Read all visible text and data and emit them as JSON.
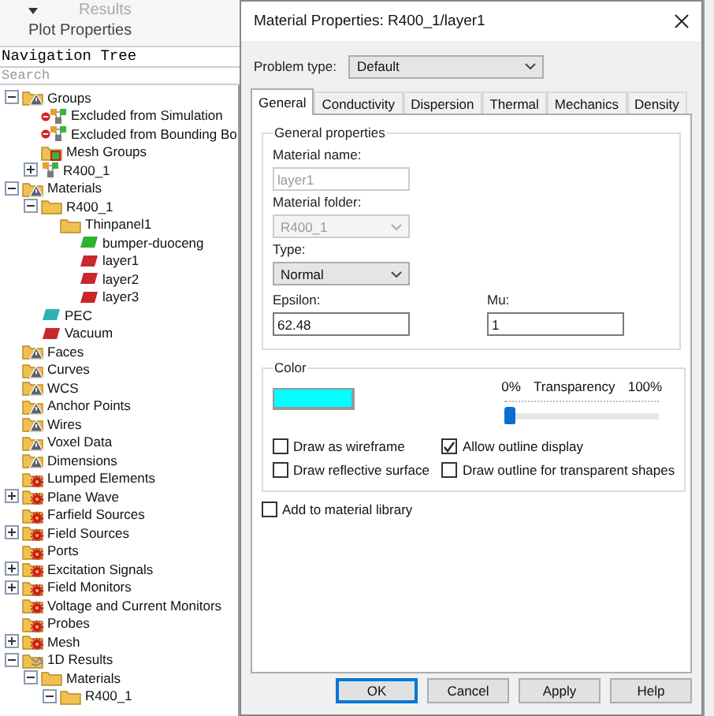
{
  "app": {
    "ribbon_tab": "Results",
    "ribbon_group": "Plot Properties"
  },
  "navigation_tree": {
    "title": "Navigation Tree",
    "search": {
      "placeholder": "Search"
    },
    "items": [
      {
        "label": "Groups",
        "kind": "warn-folder",
        "expanded": true,
        "children": [
          {
            "label": "Excluded from Simulation",
            "kind": "excluded-group"
          },
          {
            "label": "Excluded from Bounding Bo",
            "kind": "excluded-group"
          },
          {
            "label": "Mesh Groups",
            "kind": "mesh-folder"
          },
          {
            "label": "R400_1",
            "kind": "group",
            "expanded": false
          }
        ]
      },
      {
        "label": "Materials",
        "kind": "warn-folder",
        "expanded": true,
        "children": [
          {
            "label": "R400_1",
            "kind": "folder",
            "expanded": true,
            "children": [
              {
                "label": "Thinpanel1",
                "kind": "folder",
                "children": [
                  {
                    "label": "bumper-duoceng",
                    "kind": "material",
                    "color": "#2db42d"
                  },
                  {
                    "label": "layer1",
                    "kind": "material",
                    "color": "#c8282d"
                  },
                  {
                    "label": "layer2",
                    "kind": "material",
                    "color": "#c8282d"
                  },
                  {
                    "label": "layer3",
                    "kind": "material",
                    "color": "#c8282d"
                  }
                ]
              }
            ]
          },
          {
            "label": "PEC",
            "kind": "material",
            "color": "#2fb3b0"
          },
          {
            "label": "Vacuum",
            "kind": "material",
            "color": "#c8282d"
          }
        ]
      },
      {
        "label": "Faces",
        "kind": "warn-folder"
      },
      {
        "label": "Curves",
        "kind": "warn-folder"
      },
      {
        "label": "WCS",
        "kind": "warn-folder"
      },
      {
        "label": "Anchor Points",
        "kind": "warn-folder"
      },
      {
        "label": "Wires",
        "kind": "warn-folder"
      },
      {
        "label": "Voxel Data",
        "kind": "warn-folder"
      },
      {
        "label": "Dimensions",
        "kind": "warn-folder"
      },
      {
        "label": "Lumped Elements",
        "kind": "gear-folder"
      },
      {
        "label": "Plane Wave",
        "kind": "gear-folder",
        "expanded": false
      },
      {
        "label": "Farfield Sources",
        "kind": "gear-folder"
      },
      {
        "label": "Field Sources",
        "kind": "gear-folder",
        "expanded": false
      },
      {
        "label": "Ports",
        "kind": "gear-folder"
      },
      {
        "label": "Excitation Signals",
        "kind": "gear-folder",
        "expanded": false
      },
      {
        "label": "Field Monitors",
        "kind": "gear-folder",
        "expanded": false
      },
      {
        "label": "Voltage and Current Monitors",
        "kind": "gear-folder"
      },
      {
        "label": "Probes",
        "kind": "gear-folder"
      },
      {
        "label": "Mesh",
        "kind": "gear-folder",
        "expanded": false
      },
      {
        "label": "1D Results",
        "kind": "results-folder",
        "expanded": true,
        "children": [
          {
            "label": "Materials",
            "kind": "folder",
            "expanded": true,
            "children": [
              {
                "label": "R400_1",
                "kind": "folder",
                "expanded": true
              }
            ]
          }
        ]
      }
    ]
  },
  "dialog": {
    "title": "Material Properties: R400_1/layer1",
    "problem_type": {
      "label": "Problem type:",
      "value": "Default"
    },
    "tabs": [
      {
        "label": "General",
        "selected": true
      },
      {
        "label": "Conductivity",
        "selected": false
      },
      {
        "label": "Dispersion",
        "selected": false
      },
      {
        "label": "Thermal",
        "selected": false
      },
      {
        "label": "Mechanics",
        "selected": false
      },
      {
        "label": "Density",
        "selected": false
      }
    ],
    "general_properties": {
      "title": "General properties",
      "fields": [
        {
          "kind": "text",
          "label": "Material name:",
          "value": "layer1",
          "disabled": true
        },
        {
          "kind": "combo",
          "label": "Material folder:",
          "value": "R400_1",
          "disabled": true
        },
        {
          "kind": "combo",
          "label": "Type:",
          "value": "Normal",
          "disabled": false
        }
      ],
      "epsilon": {
        "label": "Epsilon:",
        "value": "62.48"
      },
      "mu": {
        "label": "Mu:",
        "value": "1"
      }
    },
    "color": {
      "title": "Color",
      "transparency": {
        "label": "Transparency",
        "min_label": "0%",
        "max_label": "100%",
        "level": 0
      },
      "options": [
        {
          "label": "Draw as wireframe",
          "checked": false
        },
        {
          "label": "Allow outline display",
          "checked": true
        },
        {
          "label": "Draw reflective surface",
          "checked": false
        },
        {
          "label": "Draw outline for transparent shapes",
          "checked": false
        }
      ]
    },
    "add_to_library": {
      "label": "Add to material library",
      "checked": false
    },
    "buttons": [
      {
        "label": "OK",
        "default": true
      },
      {
        "label": "Cancel",
        "default": false
      },
      {
        "label": "Apply",
        "default": false
      },
      {
        "label": "Help",
        "default": false
      }
    ]
  }
}
